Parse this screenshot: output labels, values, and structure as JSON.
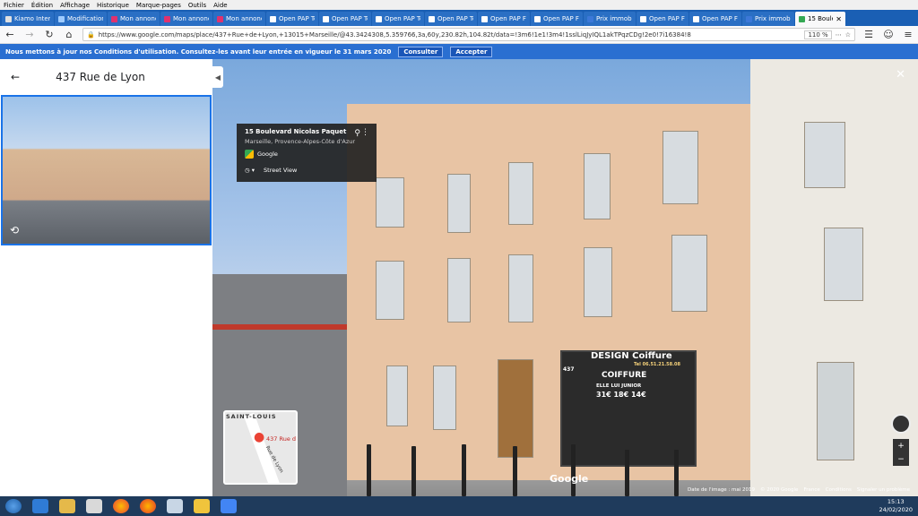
{
  "menubar": [
    "Fichier",
    "Édition",
    "Affichage",
    "Historique",
    "Marque-pages",
    "Outils",
    "Aide"
  ],
  "tabs": [
    {
      "title": "Kiamo Intera",
      "color": "#e0e0e0"
    },
    {
      "title": "Modification",
      "color": "#9ecbff"
    },
    {
      "title": "Mon annonce",
      "color": "#e0326e"
    },
    {
      "title": "Mon annonce",
      "color": "#e0326e"
    },
    {
      "title": "Mon annonce",
      "color": "#e0326e"
    },
    {
      "title": "Open PAP Tc",
      "color": "#ffffff"
    },
    {
      "title": "Open PAP Tc",
      "color": "#ffffff"
    },
    {
      "title": "Open PAP Tc",
      "color": "#ffffff"
    },
    {
      "title": "Open PAP Tc",
      "color": "#ffffff"
    },
    {
      "title": "Open PAP Fi",
      "color": "#ffffff"
    },
    {
      "title": "Open PAP Fi",
      "color": "#ffffff"
    },
    {
      "title": "Prix immobi",
      "color": "#3c78d8"
    },
    {
      "title": "Open PAP Fi",
      "color": "#ffffff"
    },
    {
      "title": "Open PAP Fi",
      "color": "#ffffff"
    },
    {
      "title": "Prix immobi",
      "color": "#3c78d8"
    }
  ],
  "active_tab": {
    "title": "15 Boule"
  },
  "address": {
    "url": "https://www.google.com/maps/place/437+Rue+de+Lyon,+13015+Marseille/@43.3424308,5.359766,3a,60y,230.82h,104.82t/data=!3m6!1e1!3m4!1sslLiqJyIQL1akTPqzCDg!2e0!7i16384!8",
    "zoom": "110 %"
  },
  "banner": {
    "text": "Nous mettons à jour nos Conditions d'utilisation. Consultez-les avant leur entrée en vigueur le 31 mars 2020",
    "consult": "Consulter",
    "accept": "Accepter"
  },
  "sidebar": {
    "title": "437 Rue de Lyon"
  },
  "card": {
    "title": "15 Boulevard Nicolas Paquet",
    "subtitle": "Marseille, Provence-Alpes-Côte d'Azur",
    "source": "Google",
    "mode": "Street View"
  },
  "shop": {
    "name": "DESIGN Coiffure",
    "phone": "Tel 06.51.21.58.08",
    "sign": "COIFFURE",
    "line1": "ELLE   LUI   JUNIOR",
    "line2": "31€   18€   14€",
    "number": "437"
  },
  "minimap": {
    "label1": "SAINT-LOUIS",
    "label2": "437 Rue d",
    "label3": "Rue de Lyon"
  },
  "footer": {
    "date": "Date de l'image : mai 2019",
    "copyright": "© 2020 Google",
    "country": "France",
    "terms": "Conditions",
    "report": "Signaler un problème"
  },
  "logo": "Google",
  "clock": {
    "time": "15:13",
    "date": "24/02/2020"
  }
}
